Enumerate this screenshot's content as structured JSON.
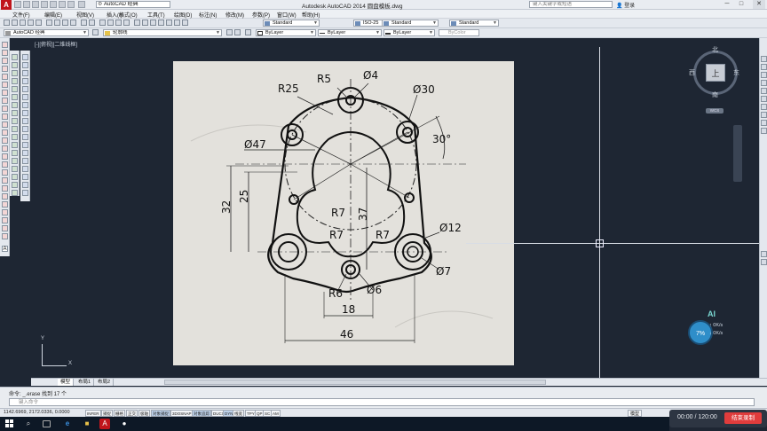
{
  "titlebar": {
    "app_logo": "A",
    "workspace": "AutoCAD 经典",
    "title": "Autodesk AutoCAD 2014   圆盘模板.dwg",
    "search_placeholder": "键入关键字或短语",
    "user": "登录",
    "minimize": "─",
    "maximize": "□",
    "close": "✕"
  },
  "menu": [
    "文件(F)",
    "编辑(E)",
    "视图(V)",
    "插入(I)",
    "格式(O)",
    "工具(T)",
    "绘图(D)",
    "标注(N)",
    "修改(M)",
    "参数(P)",
    "窗口(W)",
    "帮助(H)"
  ],
  "toolbar": {
    "text_style": "Standard",
    "dim_style": "ISO-25",
    "table_style": "Standard",
    "multileader_style": "Standard",
    "workspace2": "AutoCAD 经典",
    "layer": "轮廓线",
    "color": "ByLayer",
    "linetype": "ByLayer",
    "lineweight": "ByLayer",
    "plotstyle": "ByColor"
  },
  "viewport": {
    "label": "[-][俯视][二维线框]",
    "viewcube": {
      "top": "上",
      "north": "北",
      "south": "南",
      "east": "东",
      "west": "西",
      "wcs": "WCS"
    },
    "ucs_x": "X",
    "ucs_y": "Y"
  },
  "drawing_annotations": {
    "r25": "R25",
    "r5": "R5",
    "d4": "Ø4",
    "d30": "Ø30",
    "a30": "30°",
    "d47": "Ø47",
    "d32": "32",
    "d25": "25",
    "r7a": "R7",
    "d37": "37",
    "r7b": "R7",
    "r7c": "R7",
    "d12": "Ø12",
    "d7": "Ø7",
    "r6": "R6",
    "d6": "Ø6",
    "d18": "18",
    "d46": "46"
  },
  "speed_widget": {
    "percent": "7%",
    "ai": "AI",
    "up": "0K/s",
    "down": "0K/s"
  },
  "layout_tabs": [
    "模型",
    "布局1",
    "布局2"
  ],
  "command": {
    "history": "命令: _.erase 找到 17 个",
    "input_placeholder": "键入命令"
  },
  "status": {
    "coords": "1142.6969, 2172.0336, 0.0000",
    "buttons": [
      "INFER",
      "捕捉",
      "栅格",
      "正交",
      "极轴",
      "对象捕捉",
      "3DOSNAP",
      "对象追踪",
      "DUCS",
      "DYN",
      "线宽",
      "TPY",
      "QP",
      "SC",
      "AM"
    ],
    "active_buttons": [
      "对象捕捉",
      "对象追踪",
      "DYN"
    ],
    "model": "模型"
  },
  "recorder": {
    "time": "00:00 / 120:00",
    "stop_label": "结束录制"
  },
  "colors": {
    "accent": "#c0141b",
    "canvas": "#1e2633",
    "paper": "#e3e1dc"
  }
}
